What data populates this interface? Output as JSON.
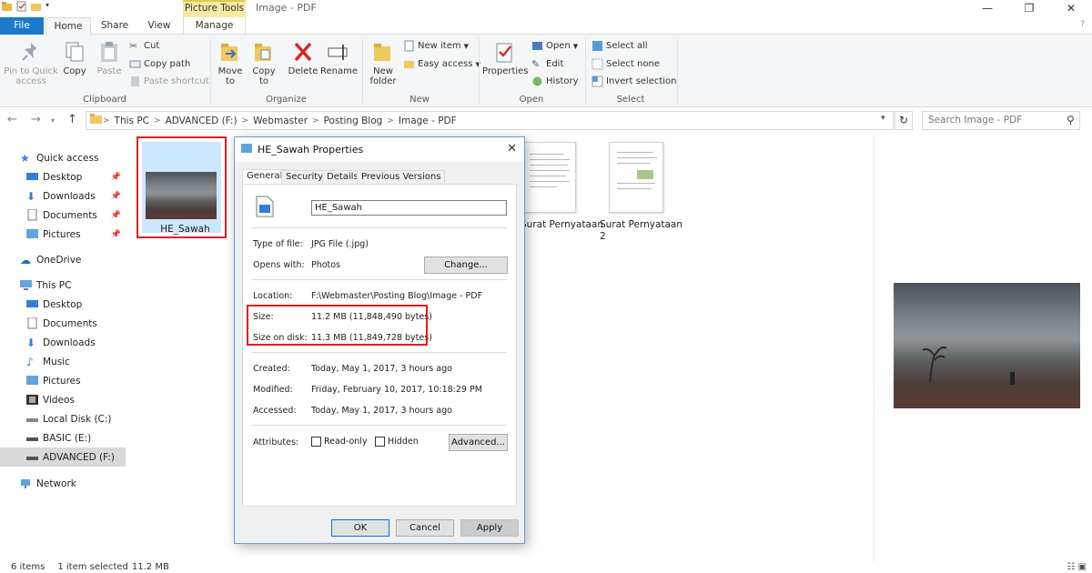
{
  "window": {
    "title": "Image - PDF",
    "picture_tools": "Picture Tools",
    "min": "—",
    "max": "❐",
    "close": "✕"
  },
  "tabs": {
    "file": "File",
    "home": "Home",
    "share": "Share",
    "view": "View",
    "manage": "Manage"
  },
  "ribbon": {
    "clipboard": {
      "label": "Clipboard",
      "pin": "Pin to Quick access",
      "copy": "Copy",
      "paste": "Paste",
      "cut": "Cut",
      "copy_path": "Copy path",
      "paste_shortcut": "Paste shortcut"
    },
    "organize": {
      "label": "Organize",
      "move_to": "Move to",
      "copy_to": "Copy to",
      "delete": "Delete",
      "rename": "Rename"
    },
    "new": {
      "label": "New",
      "new_folder": "New folder",
      "new_item": "New item",
      "easy_access": "Easy access"
    },
    "open": {
      "label": "Open",
      "properties": "Properties",
      "open": "Open",
      "edit": "Edit",
      "history": "History"
    },
    "select": {
      "label": "Select",
      "select_all": "Select all",
      "select_none": "Select none",
      "invert": "Invert selection"
    }
  },
  "address": {
    "crumbs": [
      "This PC",
      "ADVANCED (F:)",
      "Webmaster",
      "Posting Blog",
      "Image - PDF"
    ],
    "search_placeholder": "Search Image - PDF"
  },
  "navpane": {
    "quick_access": "Quick access",
    "desktop": "Desktop",
    "downloads": "Downloads",
    "documents": "Documents",
    "pictures": "Pictures",
    "onedrive": "OneDrive",
    "this_pc": "This PC",
    "pc_desktop": "Desktop",
    "pc_documents": "Documents",
    "pc_downloads": "Downloads",
    "music": "Music",
    "pc_pictures": "Pictures",
    "videos": "Videos",
    "local_disk": "Local Disk (C:)",
    "basic": "BASIC (E:)",
    "advanced": "ADVANCED (F:)",
    "network": "Network"
  },
  "files": {
    "sawah": "HE_Sawah",
    "surat1": "Surat Pernyataan",
    "surat2_line1": "Surat Pernyataan",
    "surat2_line2": "2"
  },
  "status": {
    "items": "6 items",
    "selected": "1 item selected",
    "size": "11.2 MB"
  },
  "dialog": {
    "title": "HE_Sawah Properties",
    "tabs": {
      "general": "General",
      "security": "Security",
      "details": "Details",
      "previous": "Previous Versions"
    },
    "name": "HE_Sawah",
    "type_label": "Type of file:",
    "type_value": "JPG File (.jpg)",
    "opens_label": "Opens with:",
    "opens_value": "Photos",
    "change": "Change...",
    "location_label": "Location:",
    "location_value": "F:\\Webmaster\\Posting Blog\\Image - PDF",
    "size_label": "Size:",
    "size_value": "11.2 MB (11,848,490 bytes)",
    "disk_label": "Size on disk:",
    "disk_value": "11.3 MB (11,849,728 bytes)",
    "created_label": "Created:",
    "created_value": "Today, May 1, 2017, 3 hours ago",
    "modified_label": "Modified:",
    "modified_value": "Friday, February 10, 2017, 10:18:29 PM",
    "accessed_label": "Accessed:",
    "accessed_value": "Today, May 1, 2017, 3 hours ago",
    "attributes_label": "Attributes:",
    "readonly": "Read-only",
    "hidden": "Hidden",
    "advanced": "Advanced...",
    "ok": "OK",
    "cancel": "Cancel",
    "apply": "Apply"
  },
  "colors": {
    "accent": "#1979ca",
    "highlight": "#e0201c",
    "selection": "#cce8ff"
  }
}
